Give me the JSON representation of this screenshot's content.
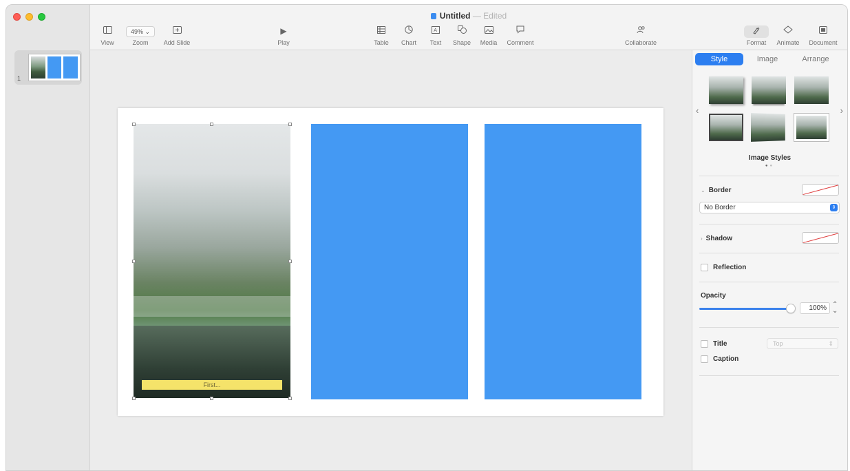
{
  "window": {
    "title": "Untitled",
    "status": "Edited"
  },
  "toolbar": {
    "view": "View",
    "zoom_value": "49%",
    "zoom": "Zoom",
    "add_slide": "Add Slide",
    "play": "Play",
    "table": "Table",
    "chart": "Chart",
    "text": "Text",
    "shape": "Shape",
    "media": "Media",
    "comment": "Comment",
    "collaborate": "Collaborate",
    "format": "Format",
    "animate": "Animate",
    "document": "Document"
  },
  "navigator": {
    "slides": [
      {
        "number": "1"
      }
    ]
  },
  "slide": {
    "caption": "First..."
  },
  "inspector": {
    "tabs": [
      "Style",
      "Image",
      "Arrange"
    ],
    "image_styles_label": "Image Styles",
    "border_label": "Border",
    "border_select": "No Border",
    "shadow_label": "Shadow",
    "reflection_label": "Reflection",
    "opacity_label": "Opacity",
    "opacity_value": "100%",
    "title_label": "Title",
    "title_position": "Top",
    "caption_label": "Caption"
  },
  "colors": {
    "accent": "#2c7ef0",
    "placeholder_blue": "#4499f3",
    "caption_bg": "#f5e36a"
  },
  "icons": {
    "view": "sidebar-icon",
    "add_slide": "plus-square-icon",
    "play": "play-icon",
    "table": "table-icon",
    "chart": "chart-icon",
    "text": "text-box-icon",
    "shape": "shape-icon",
    "media": "image-icon",
    "comment": "comment-icon",
    "collaborate": "collaborate-icon",
    "format": "paintbrush-icon",
    "animate": "diamond-icon",
    "document": "document-icon"
  }
}
